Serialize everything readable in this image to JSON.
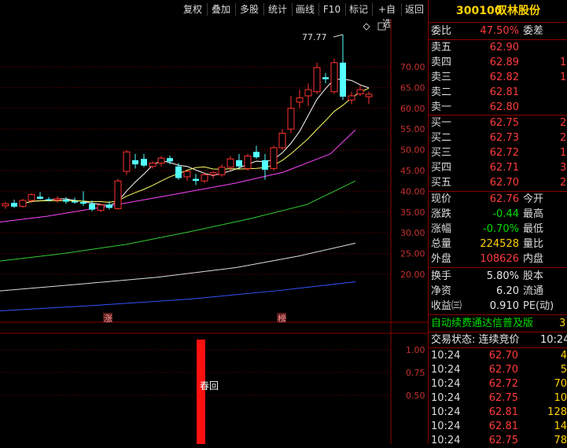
{
  "toolbar": {
    "buttons": [
      "复权",
      "叠加",
      "多股",
      "统计",
      "画线",
      "F10",
      "标记",
      "+自选",
      "返回"
    ]
  },
  "stock": {
    "code": "300100",
    "name": "双林股份"
  },
  "commission": {
    "label": "委比",
    "value": "47.50%",
    "label2": "委差"
  },
  "asks": [
    {
      "label": "卖五",
      "price": "62.90",
      "tail": ""
    },
    {
      "label": "卖四",
      "price": "62.89",
      "tail": "1"
    },
    {
      "label": "卖三",
      "price": "62.82",
      "tail": "1"
    },
    {
      "label": "卖二",
      "price": "62.81",
      "tail": ""
    },
    {
      "label": "卖一",
      "price": "62.80",
      "tail": ""
    }
  ],
  "bids": [
    {
      "label": "买一",
      "price": "62.75",
      "tail": "2"
    },
    {
      "label": "买二",
      "price": "62.73",
      "tail": "2"
    },
    {
      "label": "买三",
      "price": "62.72",
      "tail": "1"
    },
    {
      "label": "买四",
      "price": "62.71",
      "tail": "3"
    },
    {
      "label": "买五",
      "price": "62.70",
      "tail": "2"
    }
  ],
  "quote": [
    {
      "label": "现价",
      "value": "62.76",
      "label2": "今开",
      "color": "red"
    },
    {
      "label": "涨跌",
      "value": "-0.44",
      "label2": "最高",
      "color": "green"
    },
    {
      "label": "涨幅",
      "value": "-0.70%",
      "label2": "最低",
      "color": "green"
    },
    {
      "label": "总量",
      "value": "224528",
      "label2": "量比",
      "color": "yellow"
    },
    {
      "label": "外盘",
      "value": "108626",
      "label2": "内盘",
      "color": "red"
    }
  ],
  "fund": [
    {
      "label": "换手",
      "value": "5.80%",
      "label2": "股本"
    },
    {
      "label": "净资",
      "value": "6.20",
      "label2": "流通"
    },
    {
      "label": "收益㈢",
      "value": "0.910",
      "label2": "PE(动)"
    }
  ],
  "news": {
    "text": "自动续费通达信普及版",
    "tail": "3"
  },
  "trade_state": {
    "label": "交易状态: 连续竞价",
    "time": "10:24"
  },
  "ticks": [
    {
      "time": "10:24",
      "price": "62.70",
      "vol": "4"
    },
    {
      "time": "10:24",
      "price": "62.70",
      "vol": "5"
    },
    {
      "time": "10:24",
      "price": "62.72",
      "vol": "70"
    },
    {
      "time": "10:24",
      "price": "62.75",
      "vol": "10"
    },
    {
      "time": "10:24",
      "price": "62.81",
      "vol": "128"
    },
    {
      "time": "10:24",
      "price": "62.81",
      "vol": "14"
    },
    {
      "time": "10:24",
      "price": "62.75",
      "vol": "78"
    }
  ],
  "chart_data": {
    "type": "candlestick",
    "price_axis_labels": [
      "70.00",
      "65.00",
      "60.00",
      "55.00",
      "50.00",
      "45.00",
      "40.00",
      "35.00",
      "30.00",
      "25.00",
      "20.00"
    ],
    "high_annotation": "77.77",
    "markers": [
      "涨",
      "榜"
    ],
    "indicator_axis_labels": [
      "1.00",
      "0.75",
      "0.50"
    ],
    "indicator_label": "春回",
    "indicator_value": 1.0,
    "candles": [
      {
        "o": 36.5,
        "h": 37.5,
        "l": 35.8,
        "c": 37.0
      },
      {
        "o": 37.2,
        "h": 38.0,
        "l": 36.0,
        "c": 36.3
      },
      {
        "o": 36.4,
        "h": 38.2,
        "l": 36.0,
        "c": 37.8
      },
      {
        "o": 37.8,
        "h": 39.5,
        "l": 37.2,
        "c": 39.2
      },
      {
        "o": 38.7,
        "h": 39.8,
        "l": 38.0,
        "c": 38.2
      },
      {
        "o": 38.1,
        "h": 38.6,
        "l": 37.6,
        "c": 37.8
      },
      {
        "o": 37.9,
        "h": 38.8,
        "l": 37.2,
        "c": 38.2
      },
      {
        "o": 38.0,
        "h": 38.6,
        "l": 37.0,
        "c": 37.5
      },
      {
        "o": 37.6,
        "h": 38.5,
        "l": 37.0,
        "c": 37.3
      },
      {
        "o": 37.4,
        "h": 40.0,
        "l": 36.5,
        "c": 37.0
      },
      {
        "o": 37.0,
        "h": 37.8,
        "l": 35.2,
        "c": 35.6
      },
      {
        "o": 35.4,
        "h": 37.0,
        "l": 35.0,
        "c": 36.7
      },
      {
        "o": 36.8,
        "h": 37.6,
        "l": 35.6,
        "c": 36.0
      },
      {
        "o": 35.8,
        "h": 43.0,
        "l": 35.5,
        "c": 42.5
      },
      {
        "o": 44.8,
        "h": 50.0,
        "l": 44.0,
        "c": 49.5
      },
      {
        "o": 47.5,
        "h": 49.0,
        "l": 45.5,
        "c": 46.5
      },
      {
        "o": 47.8,
        "h": 49.0,
        "l": 45.8,
        "c": 46.2
      },
      {
        "o": 46.0,
        "h": 47.2,
        "l": 45.5,
        "c": 46.8
      },
      {
        "o": 46.8,
        "h": 48.5,
        "l": 46.0,
        "c": 48.0
      },
      {
        "o": 48.0,
        "h": 48.6,
        "l": 46.5,
        "c": 47.2
      },
      {
        "o": 46.0,
        "h": 46.8,
        "l": 42.8,
        "c": 43.2
      },
      {
        "o": 43.5,
        "h": 45.0,
        "l": 42.5,
        "c": 44.8
      },
      {
        "o": 43.0,
        "h": 44.2,
        "l": 41.5,
        "c": 42.5
      },
      {
        "o": 42.5,
        "h": 44.5,
        "l": 42.0,
        "c": 44.0
      },
      {
        "o": 44.0,
        "h": 44.8,
        "l": 43.0,
        "c": 44.5
      },
      {
        "o": 44.0,
        "h": 46.5,
        "l": 43.5,
        "c": 45.8
      },
      {
        "o": 45.8,
        "h": 48.5,
        "l": 45.0,
        "c": 47.8
      },
      {
        "o": 47.5,
        "h": 49.0,
        "l": 45.5,
        "c": 46.0
      },
      {
        "o": 45.5,
        "h": 49.0,
        "l": 45.0,
        "c": 48.5
      },
      {
        "o": 49.5,
        "h": 51.0,
        "l": 47.8,
        "c": 48.2
      },
      {
        "o": 47.5,
        "h": 49.0,
        "l": 42.8,
        "c": 45.2
      },
      {
        "o": 45.5,
        "h": 51.0,
        "l": 45.0,
        "c": 50.5
      },
      {
        "o": 50.5,
        "h": 55.0,
        "l": 50.0,
        "c": 54.0
      },
      {
        "o": 55.0,
        "h": 63.0,
        "l": 54.0,
        "c": 60.0
      },
      {
        "o": 61.5,
        "h": 64.5,
        "l": 60.0,
        "c": 62.5
      },
      {
        "o": 63.0,
        "h": 66.0,
        "l": 60.5,
        "c": 64.5
      },
      {
        "o": 64.0,
        "h": 71.0,
        "l": 63.5,
        "c": 69.8
      },
      {
        "o": 67.5,
        "h": 68.5,
        "l": 66.0,
        "c": 67.0
      },
      {
        "o": 64.0,
        "h": 72.0,
        "l": 63.5,
        "c": 71.0
      },
      {
        "o": 71.0,
        "h": 77.77,
        "l": 62.0,
        "c": 62.8
      },
      {
        "o": 62.0,
        "h": 64.0,
        "l": 61.0,
        "c": 63.0
      },
      {
        "o": 63.5,
        "h": 65.5,
        "l": 63.0,
        "c": 64.5
      },
      {
        "o": 62.8,
        "h": 64.0,
        "l": 61.0,
        "c": 63.4
      }
    ],
    "ma_colors": [
      "#ffffff",
      "#ffff66",
      "#ff44ff",
      "#33cc33",
      "#dddddd",
      "#3355ff"
    ]
  }
}
